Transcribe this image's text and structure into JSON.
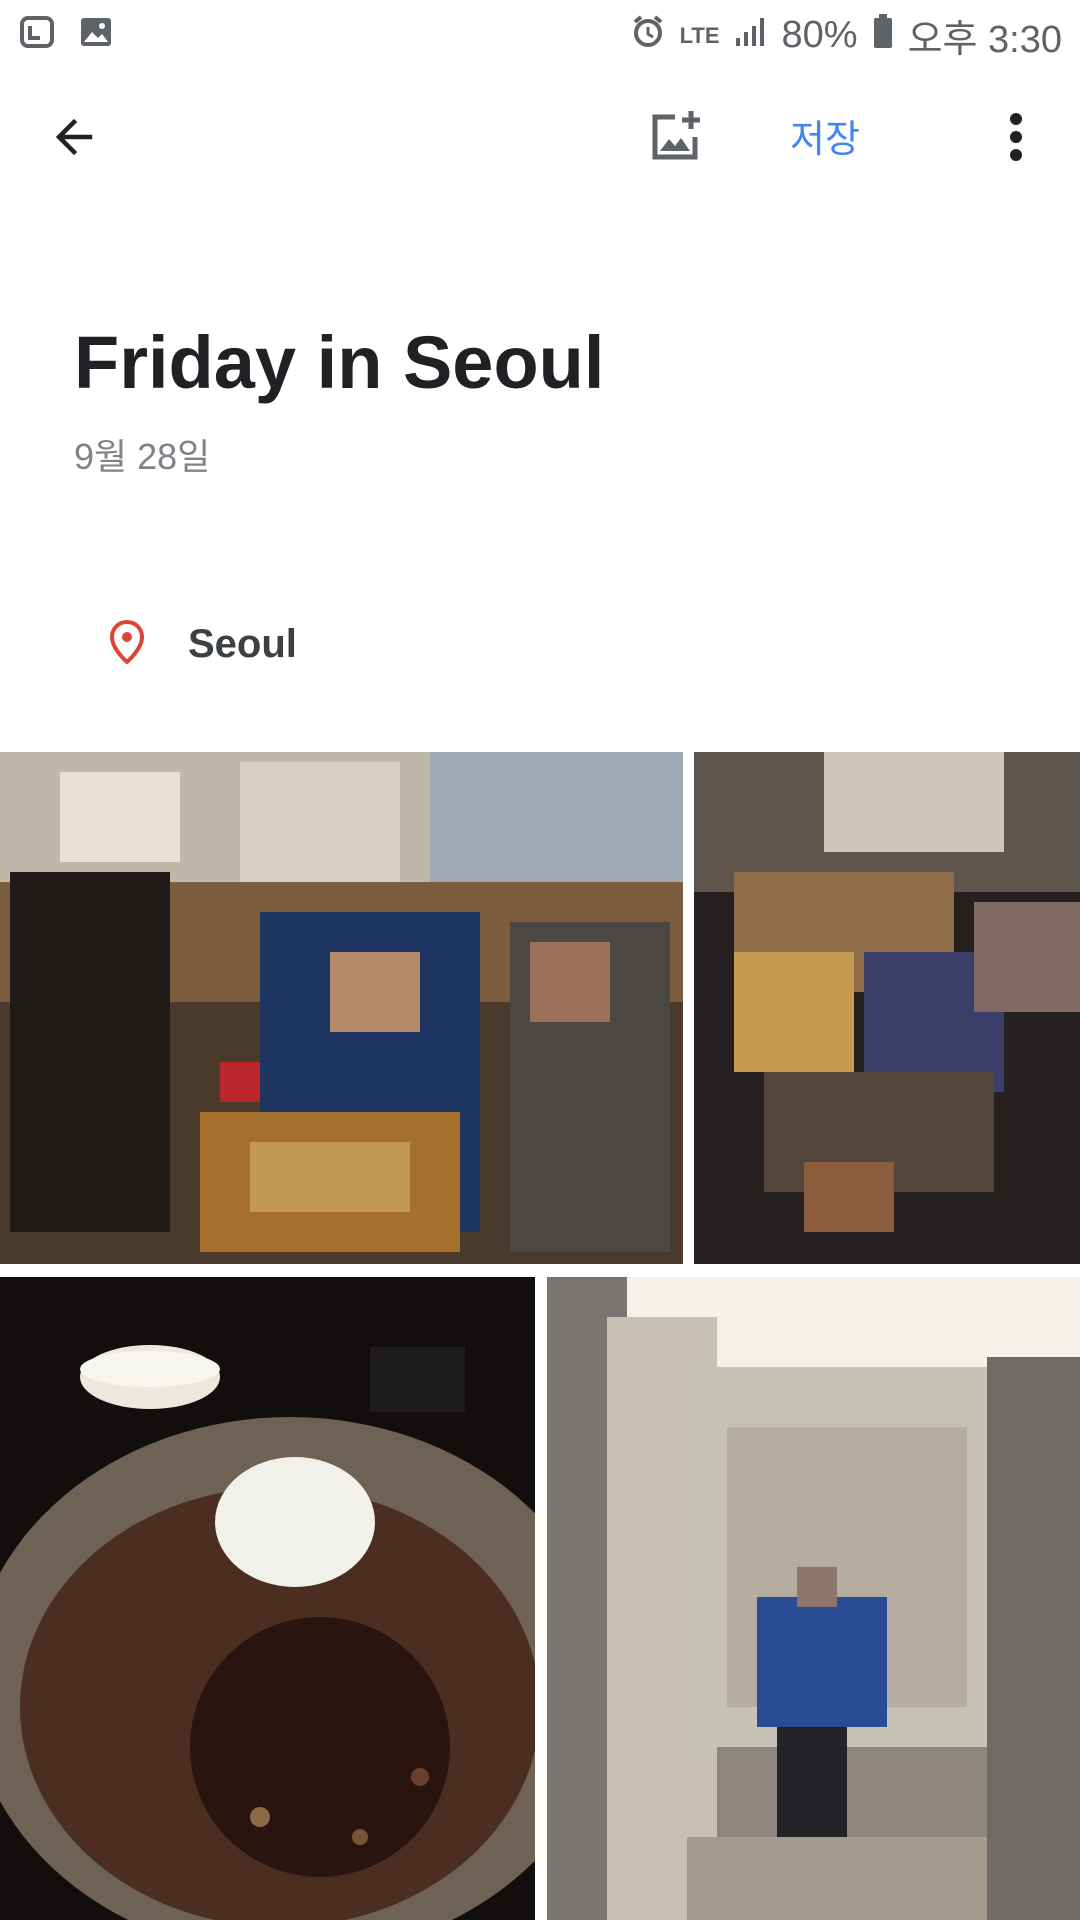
{
  "status_bar": {
    "network": "LTE",
    "battery": "80%",
    "time": "오후 3:30",
    "icons": [
      "sync-icon",
      "image-icon",
      "alarm-icon",
      "signal-icon",
      "battery-icon"
    ]
  },
  "app_bar": {
    "save_label": "저장",
    "icons": [
      "back-arrow-icon",
      "add-photo-icon",
      "more-vert-icon"
    ]
  },
  "album": {
    "title": "Friday in Seoul",
    "date": "9월 28일",
    "location": "Seoul"
  },
  "colors": {
    "accent": "#4285f4",
    "location_pin": "#db4437"
  }
}
